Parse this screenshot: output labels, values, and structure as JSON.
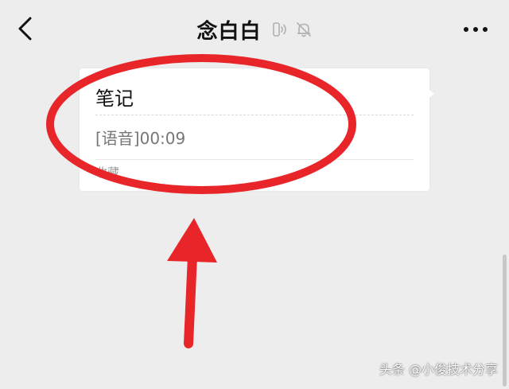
{
  "header": {
    "title": "念白白",
    "icons": [
      "voice-notify-icon",
      "mute-bell-icon",
      "back-chevron-icon",
      "more-dots-icon"
    ]
  },
  "card": {
    "title": "笔记",
    "content": "[语音]00:09",
    "footer": "收藏"
  },
  "watermark": "头条 @小俊技术分享",
  "colors": {
    "background": "#ededed",
    "card": "#ffffff",
    "annotation_red": "#e8262a"
  }
}
